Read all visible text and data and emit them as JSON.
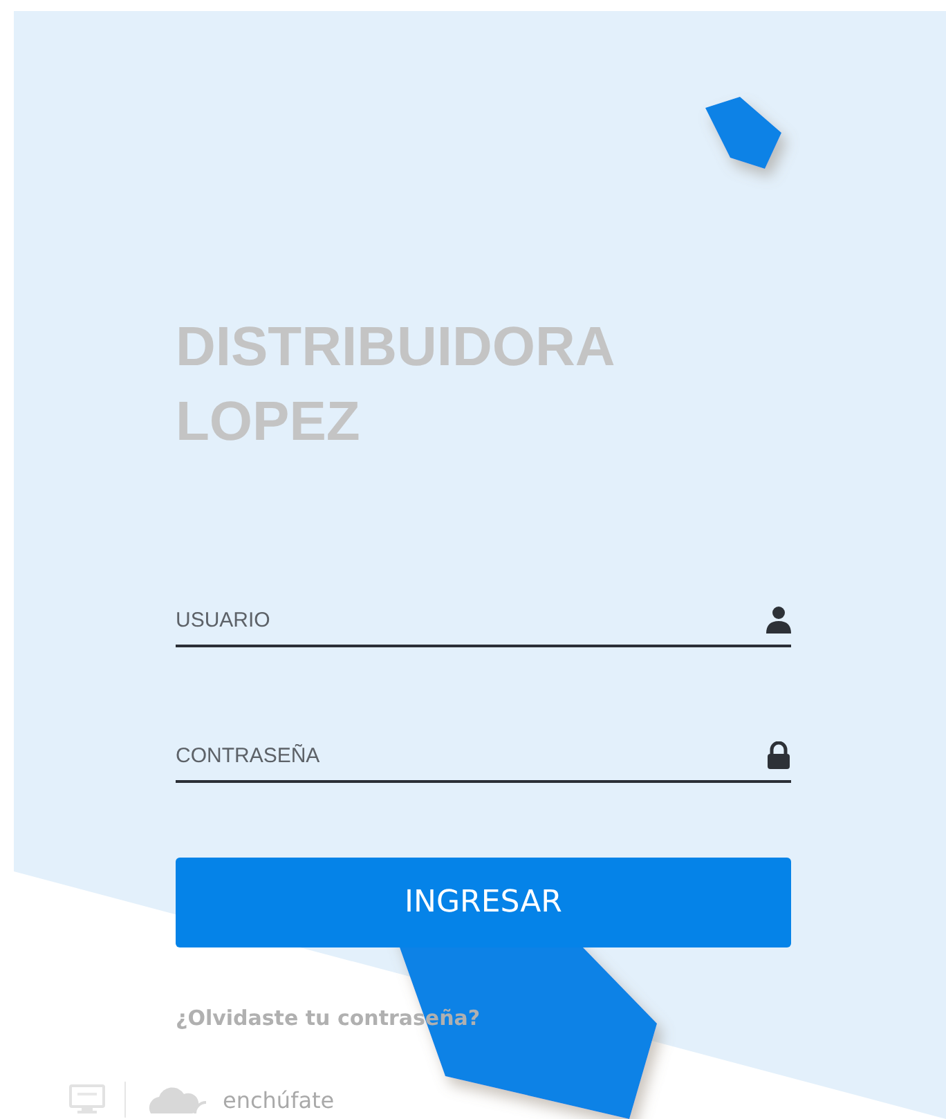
{
  "title_lines": [
    "DISTRIBUIDORA",
    "LOPEZ"
  ],
  "fields": [
    {
      "placeholder": "USUARIO",
      "kind": "user"
    },
    {
      "placeholder": "CONTRASEÑA",
      "kind": "password"
    }
  ],
  "submit_button": "INGRESAR",
  "forgot_link": "¿Olvidaste tu contraseña?",
  "footer": {
    "brand": "enchúfate"
  }
}
